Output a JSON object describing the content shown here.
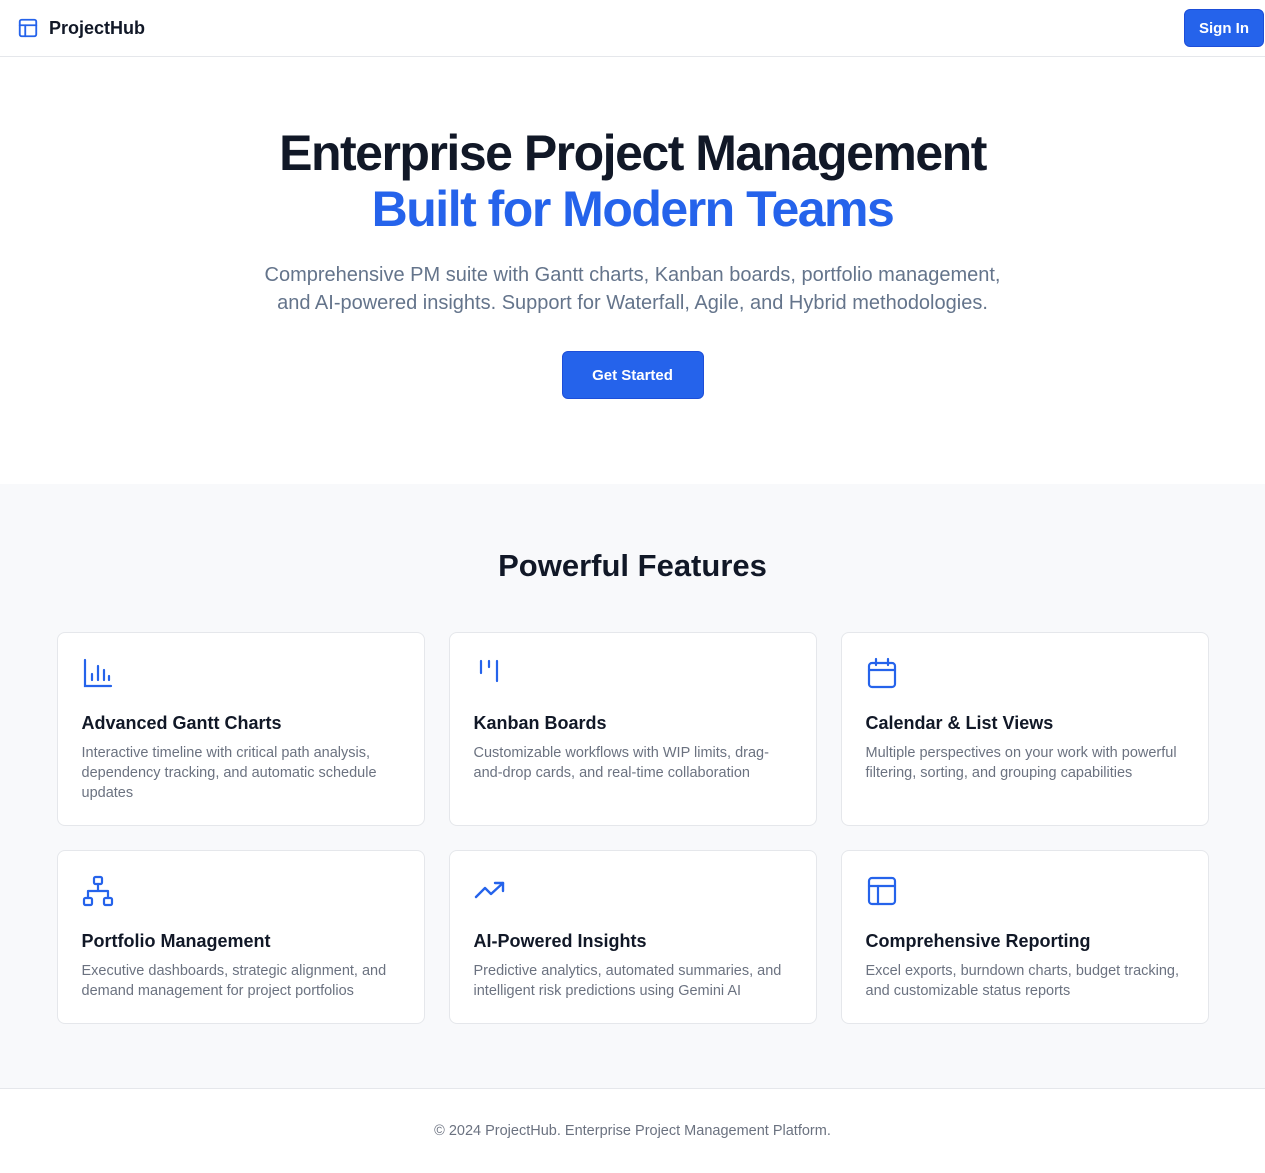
{
  "colors": {
    "accent": "#2563eb",
    "text": "#111827",
    "muted": "#6b7280",
    "section_bg": "#f8f9fb"
  },
  "header": {
    "brand_icon": "layout-icon",
    "brand_name": "ProjectHub",
    "signin_label": "Sign In"
  },
  "hero": {
    "title_line1": "Enterprise Project Management",
    "title_line2": "Built for Modern Teams",
    "subtitle": "Comprehensive PM suite with Gantt charts, Kanban boards, portfolio management, and AI-powered insights. Support for Waterfall, Agile, and Hybrid methodologies.",
    "cta_label": "Get Started"
  },
  "features": {
    "title": "Powerful Features",
    "items": [
      {
        "icon": "bar-chart-icon",
        "title": "Advanced Gantt Charts",
        "description": "Interactive timeline with critical path analysis, dependency tracking, and automatic schedule updates"
      },
      {
        "icon": "kanban-icon",
        "title": "Kanban Boards",
        "description": "Customizable workflows with WIP limits, drag-and-drop cards, and real-time collaboration"
      },
      {
        "icon": "calendar-icon",
        "title": "Calendar & List Views",
        "description": "Multiple perspectives on your work with powerful filtering, sorting, and grouping capabilities"
      },
      {
        "icon": "network-icon",
        "title": "Portfolio Management",
        "description": "Executive dashboards, strategic alignment, and demand management for project portfolios"
      },
      {
        "icon": "trending-up-icon",
        "title": "AI-Powered Insights",
        "description": "Predictive analytics, automated summaries, and intelligent risk predictions using Gemini AI"
      },
      {
        "icon": "layout-icon",
        "title": "Comprehensive Reporting",
        "description": "Excel exports, burndown charts, budget tracking, and customizable status reports"
      }
    ]
  },
  "footer": {
    "text": "© 2024 ProjectHub. Enterprise Project Management Platform."
  }
}
